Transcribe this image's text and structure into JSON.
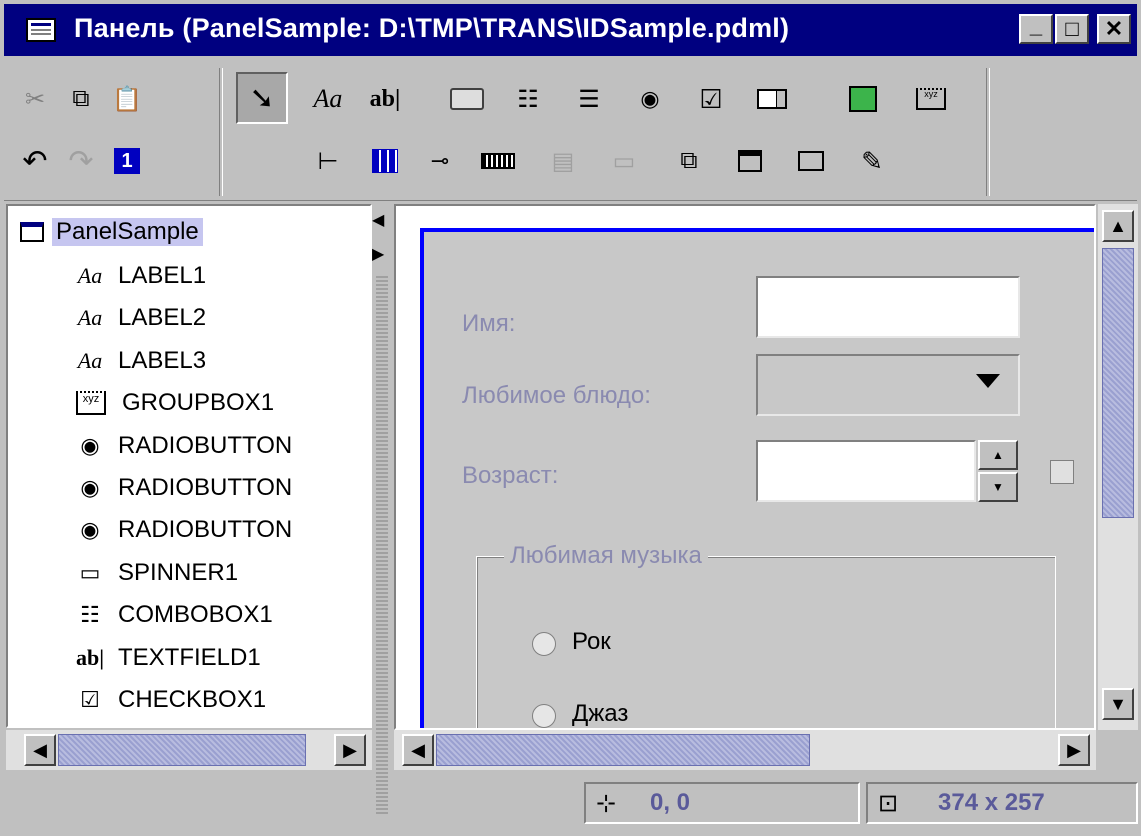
{
  "window": {
    "title": "Панель (PanelSample: D:\\TMP\\TRANS\\IDSample.pdml)",
    "minimize": "_",
    "maximize": "□",
    "close": "✕"
  },
  "toolbar": {
    "row1_left": [
      "cut-icon",
      "copy-icon",
      "paste-icon"
    ],
    "row1_tools": [
      "pointer-icon",
      "label-icon",
      "textfield-icon",
      "button-icon",
      "combobox-icon",
      "list-icon",
      "radiobutton-icon",
      "checkbox-icon",
      "spinner-icon",
      "image-icon",
      "groupbox-icon"
    ],
    "row2_left": [
      "undo-icon",
      "redo-icon",
      "number-icon"
    ],
    "row2_tools": [
      "tree-icon",
      "table-icon",
      "slider-icon",
      "progressbar-icon",
      "textarea-icon",
      "scrollbar-icon",
      "tabbedpane-icon",
      "menubar-icon",
      "panel-icon",
      "editor-icon"
    ],
    "label_glyph": "Aa",
    "textfield_glyph": "ab|",
    "number_glyph": "1"
  },
  "tree": {
    "root": "PanelSample",
    "items": [
      {
        "icon": "Aa",
        "label": "LABEL1"
      },
      {
        "icon": "Aa",
        "label": "LABEL2"
      },
      {
        "icon": "Aa",
        "label": "LABEL3"
      },
      {
        "icon": "xyz",
        "label": "GROUPBOX1"
      },
      {
        "icon": "◉",
        "label": "RADIOBUTTON"
      },
      {
        "icon": "◉",
        "label": "RADIOBUTTON"
      },
      {
        "icon": "◉",
        "label": "RADIOBUTTON"
      },
      {
        "icon": "▭",
        "label": "SPINNER1"
      },
      {
        "icon": "☷",
        "label": "COMBOBOX1"
      },
      {
        "icon": "ab|",
        "label": "TEXTFIELD1"
      },
      {
        "icon": "☑",
        "label": "CHECKBOX1"
      }
    ]
  },
  "form": {
    "name_label": "Имя:",
    "dish_label": "Любимое блюдо:",
    "age_label": "Возраст:",
    "music_group": "Любимая музыка",
    "radio1": "Рок",
    "radio2": "Джаз"
  },
  "status": {
    "position": "0, 0",
    "size": "374 x 257"
  },
  "colors": {
    "titlebar": "#000080",
    "selection": "#c6c6f0",
    "canvas_border": "#0000ff"
  }
}
